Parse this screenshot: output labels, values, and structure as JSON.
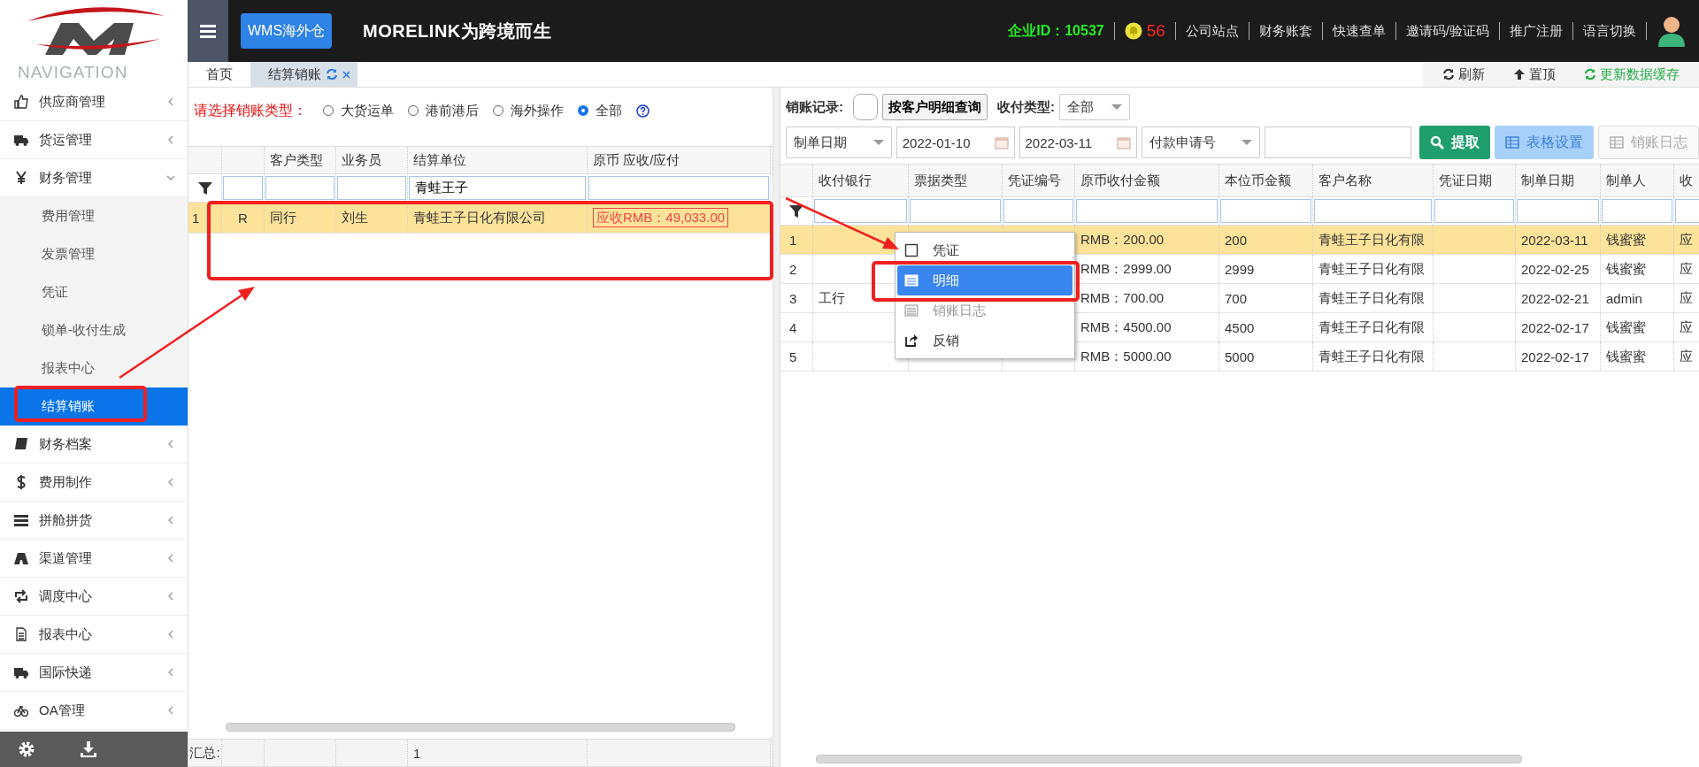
{
  "header": {
    "badge": "WMS海外仓",
    "title": "MORELINK为跨境而生",
    "company_id": "企业ID：10537",
    "notifications": "56",
    "links": [
      "公司站点",
      "财务账套",
      "快速查单",
      "邀请码/验证码",
      "推广注册",
      "语言切换"
    ]
  },
  "sidebar": {
    "heading": "NAVIGATION",
    "items": [
      {
        "label": "供应商管理",
        "expanded": false
      },
      {
        "label": "货运管理",
        "expanded": false
      },
      {
        "label": "财务管理",
        "expanded": true,
        "children": [
          {
            "label": "费用管理",
            "selected": false
          },
          {
            "label": "发票管理",
            "selected": false
          },
          {
            "label": "凭证",
            "selected": false
          },
          {
            "label": "锁单-收付生成",
            "selected": false
          },
          {
            "label": "报表中心",
            "selected": false
          },
          {
            "label": "结算销账",
            "selected": true
          }
        ]
      },
      {
        "label": "财务档案",
        "expanded": false
      },
      {
        "label": "费用制作",
        "expanded": false
      },
      {
        "label": "拼舱拼货",
        "expanded": false
      },
      {
        "label": "渠道管理",
        "expanded": false
      },
      {
        "label": "调度中心",
        "expanded": false
      },
      {
        "label": "报表中心",
        "expanded": false
      },
      {
        "label": "国际快递",
        "expanded": false
      },
      {
        "label": "OA管理",
        "expanded": false
      }
    ]
  },
  "tabs": [
    {
      "label": "首页",
      "selected": false
    },
    {
      "label": "结算销账",
      "selected": true
    }
  ],
  "toolbar": [
    {
      "label": "刷新",
      "color": "#333333"
    },
    {
      "label": "置顶",
      "color": "#333333"
    },
    {
      "label": "更新数据缓存",
      "color": "#22aa44"
    }
  ],
  "left_panel": {
    "type_label": "请选择销账类型：",
    "radios": [
      {
        "label": "大货运单",
        "selected": false
      },
      {
        "label": "港前港后",
        "selected": false
      },
      {
        "label": "海外操作",
        "selected": false
      },
      {
        "label": "全部",
        "selected": true
      }
    ],
    "columns": [
      {
        "label": "客户类型"
      },
      {
        "label": "业务员"
      },
      {
        "label": "结算单位",
        "filter": "青蛙王子"
      },
      {
        "label": "原币 应收/应付"
      }
    ],
    "rows": [
      {
        "number": "1",
        "flag": "R",
        "cells": [
          "同行",
          "刘生",
          "青蛙王子日化有限公司",
          "应收RMB：49,033.00"
        ],
        "selected": true
      }
    ],
    "summary": {
      "label": "汇总:",
      "count": "1"
    }
  },
  "right_panel": {
    "record_label": "销账记录:",
    "switch": {
      "on": false
    },
    "query_button": "按客户明细查询",
    "type_label": "收付类型:",
    "type_select": "全部",
    "date_select": "制单日期",
    "date_from": "2022-01-10",
    "date_to": "2022-03-11",
    "number_select": "付款申请号",
    "buttons": [
      {
        "label": "提取",
        "kind": "primary"
      },
      {
        "label": "表格设置",
        "kind": "info"
      },
      {
        "label": "销账日志",
        "kind": "disabled"
      }
    ],
    "columns": [
      "收付银行",
      "票据类型",
      "凭证编号",
      "原币收付金额",
      "本位币金额",
      "客户名称",
      "凭证日期",
      "制单日期",
      "制单人",
      "收"
    ],
    "rows": [
      {
        "number": "1",
        "cells": [
          null,
          null,
          null,
          "RMB：200.00",
          "200",
          "青蛙王子日化有限",
          null,
          "2022-03-11",
          "钱蜜蜜",
          "应"
        ],
        "selected": true
      },
      {
        "number": "2",
        "cells": [
          null,
          null,
          null,
          "RMB：2999.00",
          "2999",
          "青蛙王子日化有限",
          null,
          "2022-02-25",
          "钱蜜蜜",
          "应"
        ],
        "selected": false
      },
      {
        "number": "3",
        "cells": [
          "工行",
          null,
          null,
          "RMB：700.00",
          "700",
          "青蛙王子日化有限",
          null,
          "2022-02-21",
          "admin",
          "应"
        ],
        "selected": false
      },
      {
        "number": "4",
        "cells": [
          null,
          null,
          null,
          "RMB：4500.00",
          "4500",
          "青蛙王子日化有限",
          null,
          "2022-02-17",
          "钱蜜蜜",
          "应"
        ],
        "selected": false
      },
      {
        "number": "5",
        "cells": [
          null,
          null,
          null,
          "RMB：5000.00",
          "5000",
          "青蛙王子日化有限",
          null,
          "2022-02-17",
          "钱蜜蜜",
          "应"
        ],
        "selected": false
      }
    ],
    "context_menu": [
      {
        "label": "凭证",
        "selected": false,
        "disabled": false
      },
      {
        "label": "明细",
        "selected": true,
        "disabled": false
      },
      {
        "label": "销账日志",
        "selected": false,
        "disabled": true
      },
      {
        "label": "反销",
        "selected": false,
        "disabled": false
      }
    ]
  }
}
